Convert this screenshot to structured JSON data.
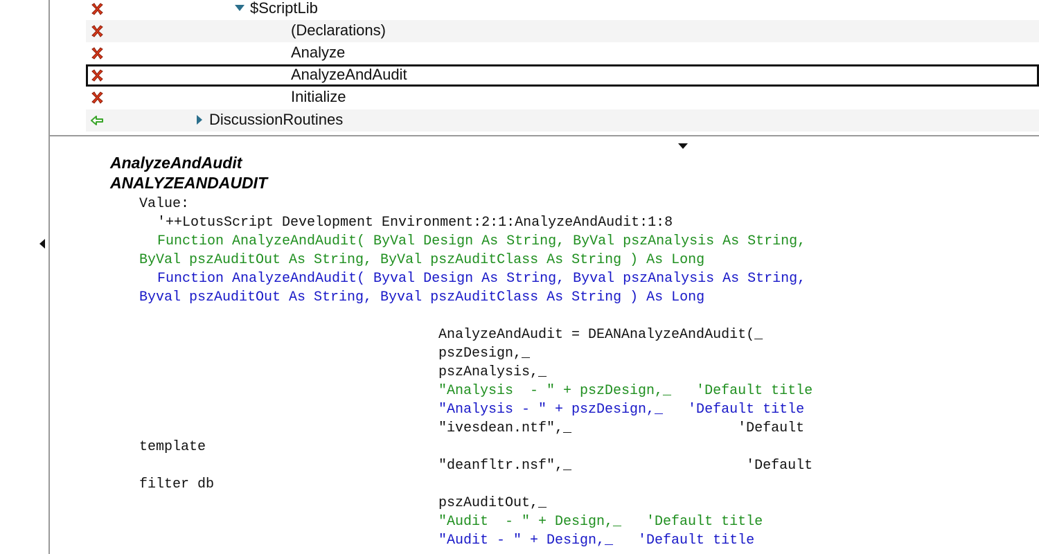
{
  "tree": {
    "rows": [
      {
        "label": "$ScriptLib",
        "icon": "delete-x-icon"
      },
      {
        "label": "(Declarations)",
        "icon": "delete-x-icon"
      },
      {
        "label": "Analyze",
        "icon": "delete-x-icon"
      },
      {
        "label": "AnalyzeAndAudit",
        "icon": "delete-x-icon"
      },
      {
        "label": "Initialize",
        "icon": "delete-x-icon"
      },
      {
        "label": "DiscussionRoutines",
        "icon": "back-arrow-icon"
      }
    ]
  },
  "details": {
    "title": "AnalyzeAndAudit",
    "title_upper": "ANALYZEANDAUDIT",
    "value_label": "Value:",
    "lines": [
      {
        "text": "'++LotusScript Development Environment:2:1:AnalyzeAndAudit:1:8",
        "color": "black"
      },
      {
        "text": "Function AnalyzeAndAudit( ByVal Design As String, ByVal pszAnalysis As String,",
        "color": "green"
      },
      {
        "text": "ByVal pszAuditOut As String, ByVal pszAuditClass As String ) As Long",
        "color": "green"
      },
      {
        "text": "Function AnalyzeAndAudit( Byval Design As String, Byval pszAnalysis As String,",
        "color": "blue"
      },
      {
        "text": "Byval pszAuditOut As String, Byval pszAuditClass As String ) As Long",
        "color": "blue"
      },
      {
        "text": "AnalyzeAndAudit = DEANAnalyzeAndAudit(_",
        "color": "black"
      },
      {
        "text": "pszDesign,_",
        "color": "black"
      },
      {
        "text": "pszAnalysis,_",
        "color": "black"
      },
      {
        "text": "\"Analysis  - \" + pszDesign,_   'Default title",
        "color": "green"
      },
      {
        "text": "\"Analysis - \" + pszDesign,_   'Default title",
        "color": "blue"
      },
      {
        "text": "\"ivesdean.ntf\",_                    'Default",
        "color": "black"
      },
      {
        "text": "template",
        "color": "black"
      },
      {
        "text": "\"deanfltr.nsf\",_                     'Default",
        "color": "black"
      },
      {
        "text": "filter db",
        "color": "black"
      },
      {
        "text": "pszAuditOut,_",
        "color": "black"
      },
      {
        "text": "\"Audit  - \" + Design,_   'Default title",
        "color": "green"
      },
      {
        "text": "\"Audit - \" + Design,_   'Default title",
        "color": "blue"
      }
    ]
  },
  "colors": {
    "code_green": "#1f8f1f",
    "code_blue": "#1818c8",
    "twisty": "#2b6f8c",
    "delete_icon": "#d93a1c",
    "back_arrow_icon": "#3aa52a"
  }
}
